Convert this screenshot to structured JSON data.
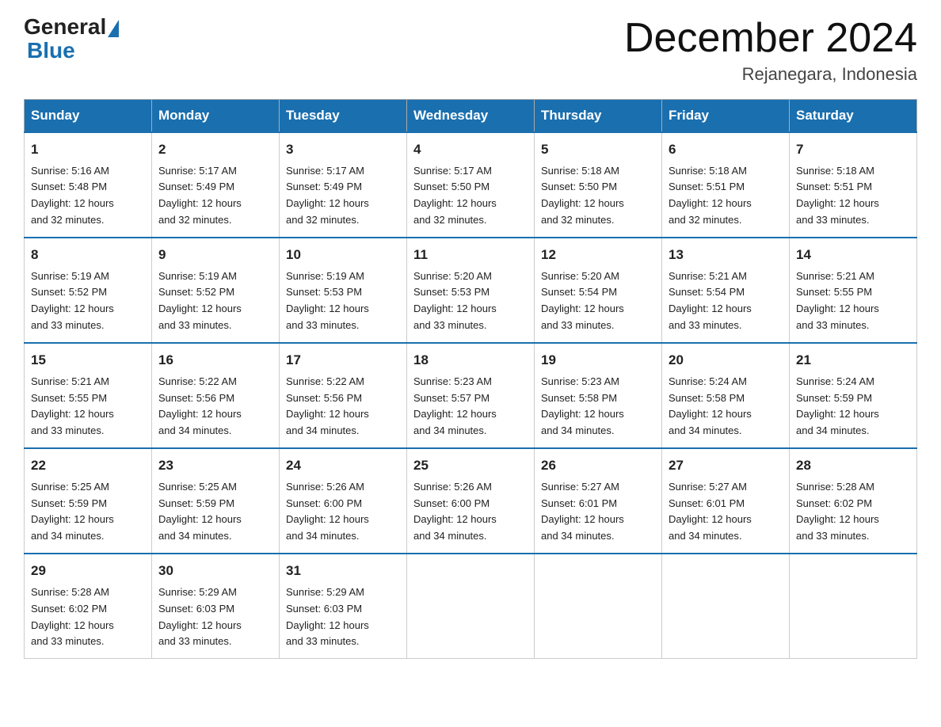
{
  "header": {
    "logo_general": "General",
    "logo_blue": "Blue",
    "month_title": "December 2024",
    "location": "Rejanegara, Indonesia"
  },
  "days_of_week": [
    "Sunday",
    "Monday",
    "Tuesday",
    "Wednesday",
    "Thursday",
    "Friday",
    "Saturday"
  ],
  "weeks": [
    [
      {
        "day": "1",
        "sunrise": "5:16 AM",
        "sunset": "5:48 PM",
        "daylight": "12 hours and 32 minutes."
      },
      {
        "day": "2",
        "sunrise": "5:17 AM",
        "sunset": "5:49 PM",
        "daylight": "12 hours and 32 minutes."
      },
      {
        "day": "3",
        "sunrise": "5:17 AM",
        "sunset": "5:49 PM",
        "daylight": "12 hours and 32 minutes."
      },
      {
        "day": "4",
        "sunrise": "5:17 AM",
        "sunset": "5:50 PM",
        "daylight": "12 hours and 32 minutes."
      },
      {
        "day": "5",
        "sunrise": "5:18 AM",
        "sunset": "5:50 PM",
        "daylight": "12 hours and 32 minutes."
      },
      {
        "day": "6",
        "sunrise": "5:18 AM",
        "sunset": "5:51 PM",
        "daylight": "12 hours and 32 minutes."
      },
      {
        "day": "7",
        "sunrise": "5:18 AM",
        "sunset": "5:51 PM",
        "daylight": "12 hours and 33 minutes."
      }
    ],
    [
      {
        "day": "8",
        "sunrise": "5:19 AM",
        "sunset": "5:52 PM",
        "daylight": "12 hours and 33 minutes."
      },
      {
        "day": "9",
        "sunrise": "5:19 AM",
        "sunset": "5:52 PM",
        "daylight": "12 hours and 33 minutes."
      },
      {
        "day": "10",
        "sunrise": "5:19 AM",
        "sunset": "5:53 PM",
        "daylight": "12 hours and 33 minutes."
      },
      {
        "day": "11",
        "sunrise": "5:20 AM",
        "sunset": "5:53 PM",
        "daylight": "12 hours and 33 minutes."
      },
      {
        "day": "12",
        "sunrise": "5:20 AM",
        "sunset": "5:54 PM",
        "daylight": "12 hours and 33 minutes."
      },
      {
        "day": "13",
        "sunrise": "5:21 AM",
        "sunset": "5:54 PM",
        "daylight": "12 hours and 33 minutes."
      },
      {
        "day": "14",
        "sunrise": "5:21 AM",
        "sunset": "5:55 PM",
        "daylight": "12 hours and 33 minutes."
      }
    ],
    [
      {
        "day": "15",
        "sunrise": "5:21 AM",
        "sunset": "5:55 PM",
        "daylight": "12 hours and 33 minutes."
      },
      {
        "day": "16",
        "sunrise": "5:22 AM",
        "sunset": "5:56 PM",
        "daylight": "12 hours and 34 minutes."
      },
      {
        "day": "17",
        "sunrise": "5:22 AM",
        "sunset": "5:56 PM",
        "daylight": "12 hours and 34 minutes."
      },
      {
        "day": "18",
        "sunrise": "5:23 AM",
        "sunset": "5:57 PM",
        "daylight": "12 hours and 34 minutes."
      },
      {
        "day": "19",
        "sunrise": "5:23 AM",
        "sunset": "5:58 PM",
        "daylight": "12 hours and 34 minutes."
      },
      {
        "day": "20",
        "sunrise": "5:24 AM",
        "sunset": "5:58 PM",
        "daylight": "12 hours and 34 minutes."
      },
      {
        "day": "21",
        "sunrise": "5:24 AM",
        "sunset": "5:59 PM",
        "daylight": "12 hours and 34 minutes."
      }
    ],
    [
      {
        "day": "22",
        "sunrise": "5:25 AM",
        "sunset": "5:59 PM",
        "daylight": "12 hours and 34 minutes."
      },
      {
        "day": "23",
        "sunrise": "5:25 AM",
        "sunset": "5:59 PM",
        "daylight": "12 hours and 34 minutes."
      },
      {
        "day": "24",
        "sunrise": "5:26 AM",
        "sunset": "6:00 PM",
        "daylight": "12 hours and 34 minutes."
      },
      {
        "day": "25",
        "sunrise": "5:26 AM",
        "sunset": "6:00 PM",
        "daylight": "12 hours and 34 minutes."
      },
      {
        "day": "26",
        "sunrise": "5:27 AM",
        "sunset": "6:01 PM",
        "daylight": "12 hours and 34 minutes."
      },
      {
        "day": "27",
        "sunrise": "5:27 AM",
        "sunset": "6:01 PM",
        "daylight": "12 hours and 34 minutes."
      },
      {
        "day": "28",
        "sunrise": "5:28 AM",
        "sunset": "6:02 PM",
        "daylight": "12 hours and 33 minutes."
      }
    ],
    [
      {
        "day": "29",
        "sunrise": "5:28 AM",
        "sunset": "6:02 PM",
        "daylight": "12 hours and 33 minutes."
      },
      {
        "day": "30",
        "sunrise": "5:29 AM",
        "sunset": "6:03 PM",
        "daylight": "12 hours and 33 minutes."
      },
      {
        "day": "31",
        "sunrise": "5:29 AM",
        "sunset": "6:03 PM",
        "daylight": "12 hours and 33 minutes."
      },
      null,
      null,
      null,
      null
    ]
  ],
  "labels": {
    "sunrise": "Sunrise:",
    "sunset": "Sunset:",
    "daylight": "Daylight:"
  }
}
